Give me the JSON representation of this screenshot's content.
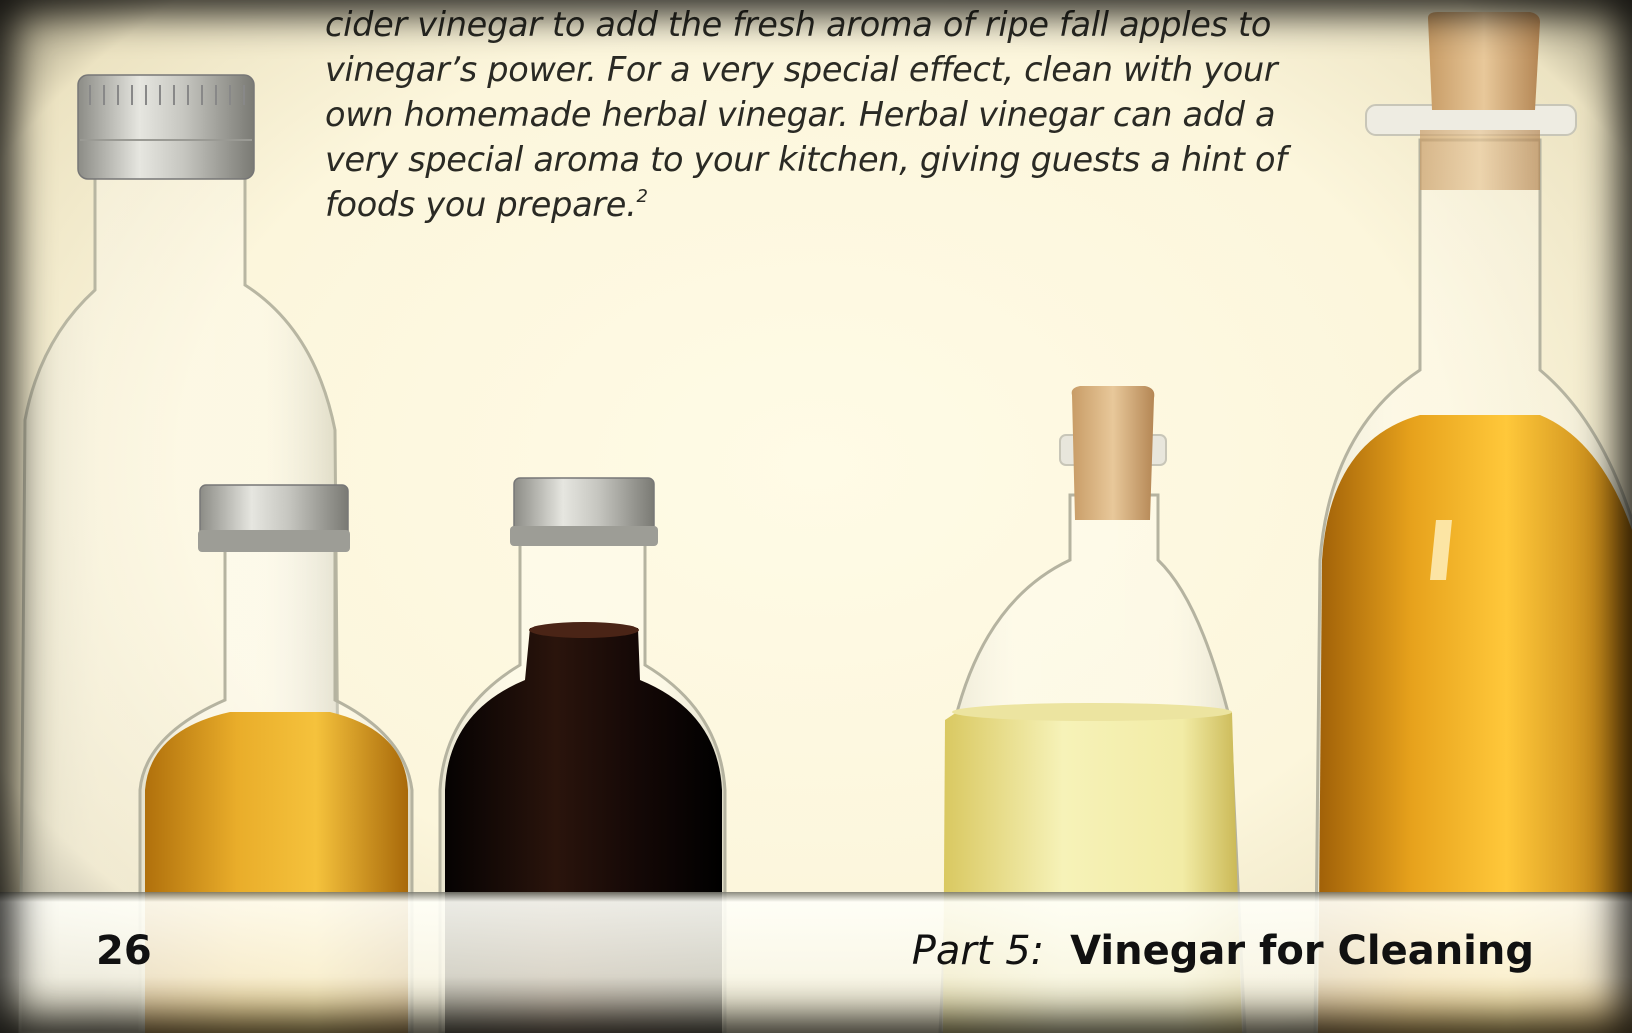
{
  "body_lines": [
    "cider vinegar to add the fresh aroma of ripe fall apples to",
    "vinegar’s power. For a very special effect, clean with your",
    "own homemade herbal vinegar. Herbal vinegar can add a",
    "very special aroma to your kitchen, giving guests a hint of",
    "foods you prepare."
  ],
  "footnote_marker": "2",
  "footer": {
    "page_number": "26",
    "part_label": "Part 5:",
    "chapter_title": "Vinegar for Cleaning"
  },
  "colors": {
    "page_background": "#fcf6dc",
    "text": "#2a2a24",
    "dark_vinegar": "#1a0d08",
    "amber_vinegar": "#e0a020",
    "pale_vinegar": "#f3eeaa",
    "cork": "#d9b88a",
    "metal_cap": "#b5b5b0"
  }
}
